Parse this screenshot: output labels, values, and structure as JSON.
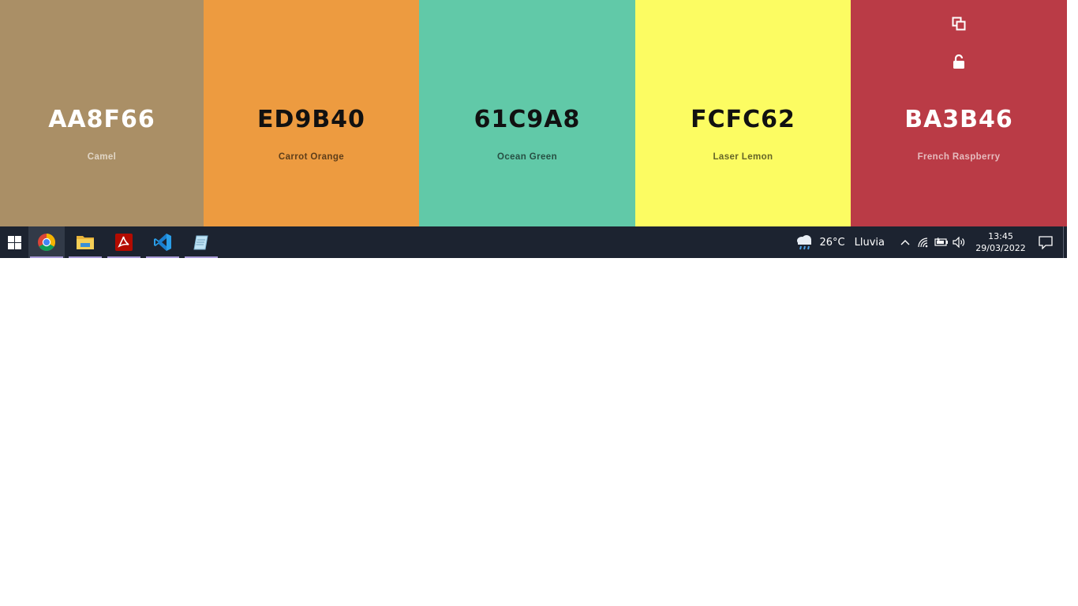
{
  "palette": {
    "swatches": [
      {
        "hex": "AA8F66",
        "name": "Camel",
        "bg": "#aa8f66",
        "hex_color": "#ffffff",
        "name_color": "#e1d6c6"
      },
      {
        "hex": "ED9B40",
        "name": "Carrot Orange",
        "bg": "#ed9b40",
        "hex_color": "#111111",
        "name_color": "#5e3e1a"
      },
      {
        "hex": "61C9A8",
        "name": "Ocean Green",
        "bg": "#61c9a8",
        "hex_color": "#111111",
        "name_color": "#275043"
      },
      {
        "hex": "FCFC62",
        "name": "Laser Lemon",
        "bg": "#fcfc62",
        "hex_color": "#111111",
        "name_color": "#656527"
      },
      {
        "hex": "BA3B46",
        "name": "French Raspberry",
        "bg": "#ba3b46",
        "hex_color": "#ffffff",
        "name_color": "#e6bcbf"
      }
    ],
    "tool_icons": [
      "copy-icon",
      "unlock-icon"
    ]
  },
  "taskbar": {
    "start_icon": "windows-logo-icon",
    "apps": [
      {
        "icon": "chrome-icon",
        "active": true
      },
      {
        "icon": "file-explorer-icon",
        "active": false
      },
      {
        "icon": "acrobat-reader-icon",
        "active": false
      },
      {
        "icon": "vscode-icon",
        "active": false
      },
      {
        "icon": "notepad-icon",
        "active": false
      }
    ],
    "weather": {
      "icon": "rain-cloud-icon",
      "temperature": "26°C",
      "condition": "Lluvia"
    },
    "tray_icons": [
      "chevron-up-icon",
      "wifi-icon",
      "battery-icon",
      "speaker-icon"
    ],
    "clock": {
      "time": "13:45",
      "date": "29/03/2022"
    },
    "notification_icon": "notification-icon"
  }
}
